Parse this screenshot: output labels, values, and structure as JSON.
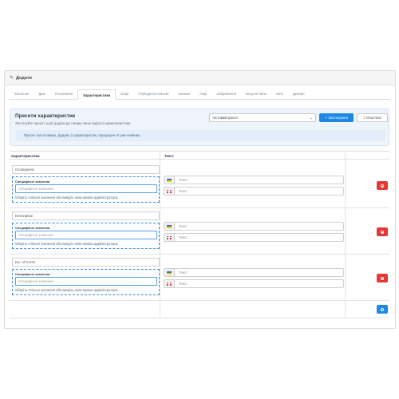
{
  "panel": {
    "title": "Додати"
  },
  "tabs": [
    {
      "label": "Загальне",
      "active": false
    },
    {
      "label": "Дані",
      "active": false
    },
    {
      "label": "Посилання",
      "active": false
    },
    {
      "label": "Характеристики",
      "active": true
    },
    {
      "label": "Опції",
      "active": false
    },
    {
      "label": "Періодичні платежі",
      "active": false
    },
    {
      "label": "Знижка",
      "active": false
    },
    {
      "label": "Акції",
      "active": false
    },
    {
      "label": "Зображення",
      "active": false
    },
    {
      "label": "Бонусні бали",
      "active": false
    },
    {
      "label": "SEO",
      "active": false
    },
    {
      "label": "Дизайн",
      "active": false
    }
  ],
  "presets": {
    "title": "Пресети характеристик",
    "description": "Застосуйте пресет, щоб додати до товару лише відсутні характеристики.",
    "selected": "тестовий пресет",
    "apply_label": "Застосувати",
    "clear_label": "Очистити",
    "alert": "Пресет застосовано. Додано 2 характеристик, пропущено 0 уже наявних."
  },
  "table": {
    "col_attribute": "Характеристика",
    "col_text": "Текст",
    "rows": [
      {
        "name": "Clockspeed",
        "value_label": "Специфічне значення",
        "value_placeholder": "Специфічне значення",
        "help": "Оберіть спільне значення або введіть нове можна адміністратора.",
        "text_ua_placeholder": "Текст",
        "text_en_placeholder": "Текст"
      },
      {
        "name": "Description",
        "value_label": "Специфічне значення",
        "value_placeholder": "Специфічне значення",
        "help": "Оберіть спільне значення або введіть нове можна адміністратора.",
        "text_ua_placeholder": "Текст",
        "text_en_placeholder": "Текст"
      },
      {
        "name": "No. of Cores",
        "value_label": "Специфічне значення",
        "value_placeholder": "Специфічне значення",
        "help": "Оберіть спільне значення або введіть нове можна адміністратора.",
        "text_ua_placeholder": "Текст",
        "text_en_placeholder": "Текст"
      }
    ]
  },
  "colors": {
    "primary": "#1e88e5",
    "danger": "#e53935",
    "presets_bg": "#eef4fb",
    "dashed_border": "#3e8ee0"
  },
  "icons": [
    "pencil-icon",
    "check-icon",
    "times-icon",
    "chevron-down-icon",
    "minus-circle-icon",
    "plus-circle-icon",
    "flag-ua-icon",
    "flag-gb-icon"
  ]
}
